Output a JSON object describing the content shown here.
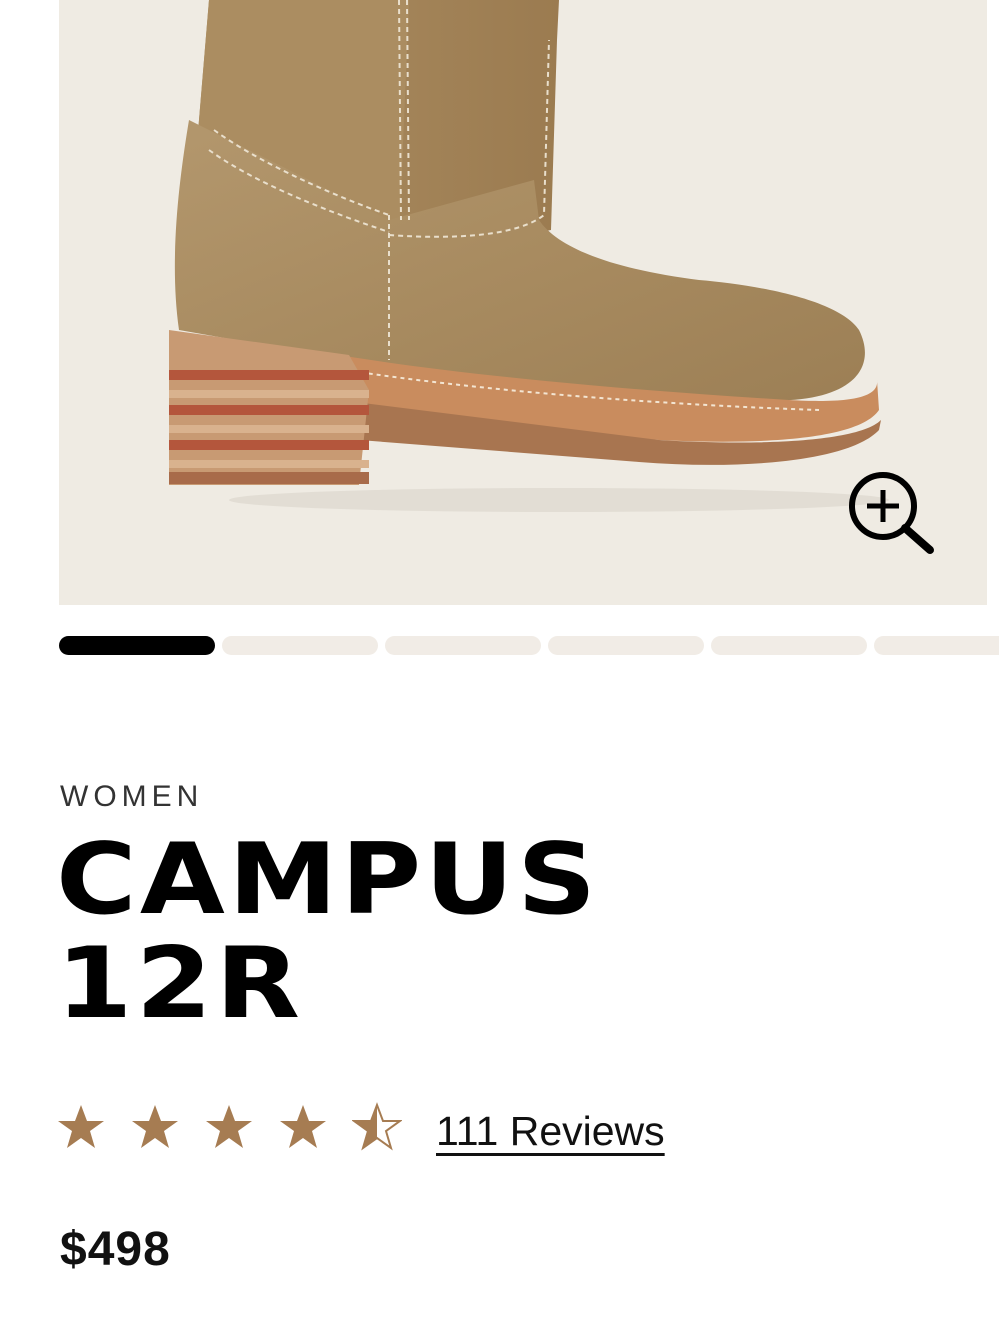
{
  "product": {
    "category": "WOMEN",
    "title_lines": [
      "CAMPUS",
      "12R"
    ],
    "price": "$498",
    "rating": {
      "value": 4.5,
      "max": 5,
      "reviews_label": "111 Reviews"
    }
  },
  "gallery": {
    "image_subject": "tan suede boot with stacked heel",
    "slide_count": 6,
    "active_slide": 1,
    "zoom_icon": "zoom-in-icon"
  },
  "colors": {
    "gallery_background": "#efebe3",
    "star_fill": "#a67c52",
    "indicator_active": "#000000",
    "indicator_inactive": "#f1ece6"
  }
}
